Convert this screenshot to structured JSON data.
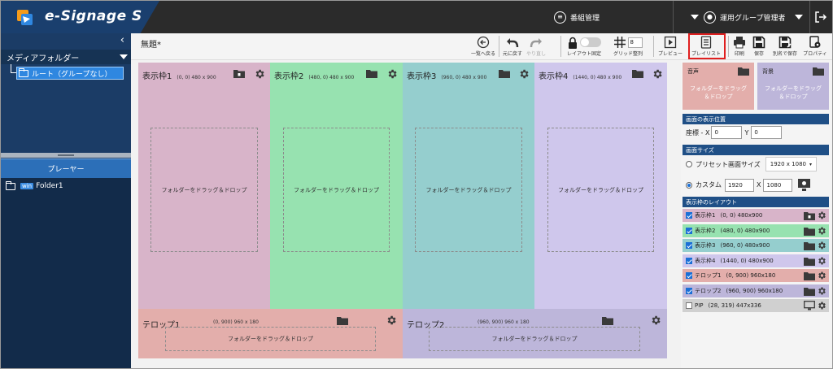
{
  "app": {
    "title": "e-Signage S"
  },
  "header": {
    "program_manage": "番組管理",
    "user": "運用グループ管理者"
  },
  "sidebar": {
    "collapse": "‹",
    "media_folder": "メディアフォルダー",
    "root": "ルート（グループなし）",
    "player": "プレーヤー",
    "player_folder_badge": "win",
    "player_folder": "Folder1"
  },
  "toolbar": {
    "title": "無題*",
    "back": "一覧へ戻る",
    "undo": "元に戻す",
    "redo": "やり直し",
    "layout_lock": "レイアウト固定",
    "grid": "グリッド整列",
    "grid_value": "8",
    "preview": "プレビュー",
    "playlist": "プレイリスト",
    "print": "印刷",
    "save": "保存",
    "save_as": "別名で保存",
    "properties": "プロパティ"
  },
  "canvas": {
    "frames": [
      {
        "title": "表示枠1",
        "meta": "(0, 0) 480 x 900",
        "drop": "フォルダーをドラッグ＆ドロップ",
        "color": "#d8b4c9"
      },
      {
        "title": "表示枠2",
        "meta": "(480, 0) 480 x 900",
        "drop": "フォルダーをドラッグ＆ドロップ",
        "color": "#97e2b0"
      },
      {
        "title": "表示枠3",
        "meta": "(960, 0) 480 x 900",
        "drop": "フォルダーをドラッグ＆ドロップ",
        "color": "#95cece"
      },
      {
        "title": "表示枠4",
        "meta": "(1440, 0) 480 x 900",
        "drop": "フォルダーをドラッグ＆ドロップ",
        "color": "#cfc7ec"
      }
    ],
    "tickers": [
      {
        "title": "テロップ1",
        "meta": "(0, 900) 960 x 180",
        "drop": "フォルダーをドラッグ＆ドロップ",
        "color": "#e3aeab"
      },
      {
        "title": "テロップ2",
        "meta": "(960, 900) 960 x 180",
        "drop": "フォルダーをドラッグ＆ドロップ",
        "color": "#bdb6da"
      }
    ]
  },
  "panel": {
    "audio": {
      "title": "音声",
      "drop": "フォルダーをドラッグ\n＆ドロップ",
      "color": "#e3aeab"
    },
    "background": {
      "title": "背景",
      "drop": "フォルダーをドラッグ\n＆ドロップ",
      "color": "#bdb6da"
    },
    "position": {
      "heading": "画面の表示位置",
      "label_x": "座標 - X",
      "x": "0",
      "label_y": "Y",
      "y": "0"
    },
    "size": {
      "heading": "画面サイズ",
      "preset_label": "プリセット画面サイズ",
      "preset_value": "1920 x 1080",
      "custom_label": "カスタム",
      "width": "1920",
      "times": "X",
      "height": "1080"
    },
    "layout": {
      "heading": "表示枠のレイアウト",
      "layers": [
        {
          "name": "表示枠1",
          "meta": "(0, 0) 480x900",
          "checked": true,
          "color": "#d8b4c9"
        },
        {
          "name": "表示枠2",
          "meta": "(480, 0) 480x900",
          "checked": true,
          "color": "#97e2b0"
        },
        {
          "name": "表示枠3",
          "meta": "(960, 0) 480x900",
          "checked": true,
          "color": "#95cece"
        },
        {
          "name": "表示枠4",
          "meta": "(1440, 0) 480x900",
          "checked": true,
          "color": "#cfc7ec"
        },
        {
          "name": "テロップ1",
          "meta": "(0, 900) 960x180",
          "checked": true,
          "color": "#e3aeab"
        },
        {
          "name": "テロップ2",
          "meta": "(960, 900) 960x180",
          "checked": true,
          "color": "#bdb6da"
        },
        {
          "name": "PIP",
          "meta": "(28, 319) 447x336",
          "checked": false,
          "color": "#d0d0d0"
        }
      ]
    }
  },
  "icons": {
    "folder": "folder-icon",
    "gear": "gear-icon",
    "lock": "lock-icon",
    "monitor": "monitor-icon"
  }
}
